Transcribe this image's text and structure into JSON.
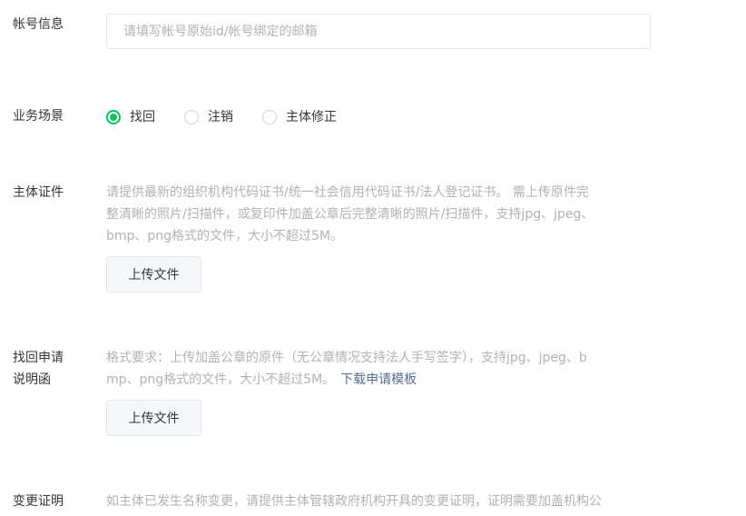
{
  "account_info": {
    "label": "帐号信息",
    "input_value": "",
    "placeholder": "请填写帐号原始id/帐号绑定的邮箱"
  },
  "business_scene": {
    "label": "业务场景",
    "options": [
      {
        "label": "找回",
        "checked": true
      },
      {
        "label": "注销",
        "checked": false
      },
      {
        "label": "主体修正",
        "checked": false
      }
    ]
  },
  "entity_cert": {
    "label": "主体证件",
    "hint_lines": [
      "请提供最新的组织机构代码证书/统一社会信用代码证书/法人登记证书。 需上传原件完",
      "整清晰的照片/扫描件，或复印件加盖公章后完整清晰的照片/扫描件，支持jpg、jpeg、",
      "bmp、png格式的文件，大小不超过5M。"
    ],
    "upload_label": "上传文件"
  },
  "recovery_letter": {
    "label_lines": [
      "找回申请",
      "说明函"
    ],
    "hint_lines": [
      "格式要求：上传加盖公章的原件（无公章情况支持法人手写签字），支持jpg、jpeg、b",
      "mp、png格式的文件，大小不超过5M。"
    ],
    "template_link": "下载申请模板",
    "upload_label": "上传文件"
  },
  "change_proof": {
    "label": "变更证明",
    "hint_lines": [
      "如主体已发生名称变更，请提供主体管辖政府机构开具的变更证明，证明需要加盖机构公"
    ]
  },
  "colors": {
    "accent_green": "#07c160",
    "link_blue": "#576b95",
    "hint_gray": "#b2b2b2",
    "text": "#353535",
    "border": "#e4e6eb",
    "button_bg": "#f6f7f9"
  }
}
